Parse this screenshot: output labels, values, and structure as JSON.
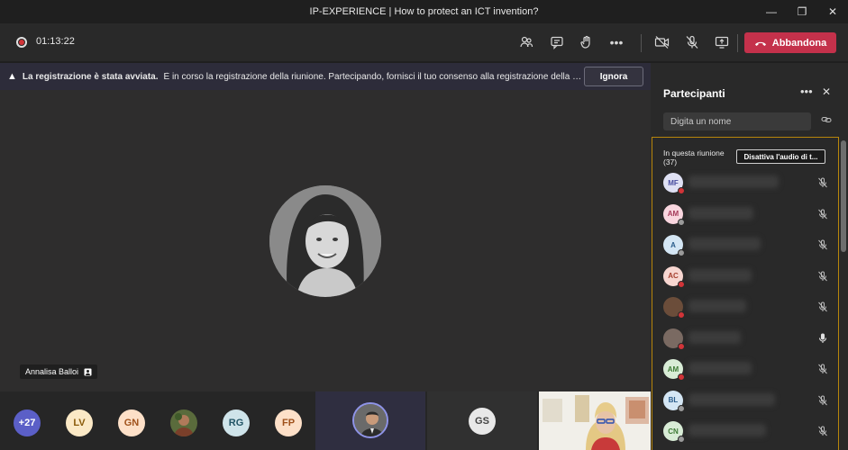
{
  "window": {
    "title": "IP-EXPERIENCE | How to protect an ICT invention?",
    "minimize": "—",
    "maximize": "❐",
    "close": "✕"
  },
  "toolbar": {
    "timer": "01:13:22",
    "leave_label": "Abbandona",
    "more": "•••"
  },
  "banner": {
    "warn_icon": "▲",
    "bold_text": "La registrazione è stata avviata.",
    "message": "È in corso la registrazione della riunione. Partecipando, fornisci il tuo consenso alla registrazione della riunio...",
    "ignore_label": "Ignora"
  },
  "stage": {
    "speaker_name": "Annalisa Balloi"
  },
  "strip": {
    "overflow_count": "+27",
    "avatars": [
      {
        "initials": "LV",
        "bg": "#fbe9c6",
        "fg": "#8a5b0a"
      },
      {
        "initials": "GN",
        "bg": "#fde0c8",
        "fg": "#a0521c"
      },
      {
        "initials": "RG",
        "bg": "#cfe4ea",
        "fg": "#225566"
      },
      {
        "initials": "FP",
        "bg": "#fde0c8",
        "fg": "#a0521c"
      }
    ],
    "gs_initials": "GS"
  },
  "panel": {
    "title": "Partecipanti",
    "more": "•••",
    "close": "✕",
    "search_placeholder": "Digita un nome",
    "section_label": "In questa riunione (37)",
    "mute_all_label": "Disattiva l'audio di t...",
    "participants": [
      {
        "initials": "MF",
        "bg": "#dfe1f4",
        "fg": "#474c9e",
        "status": "#d13438",
        "mic": "muted"
      },
      {
        "initials": "AM",
        "bg": "#f9d6df",
        "fg": "#a53a5a",
        "status": "#9a9a9a",
        "mic": "muted"
      },
      {
        "initials": "A",
        "bg": "#d4e6f4",
        "fg": "#2a5c8a",
        "status": "#9a9a9a",
        "mic": "muted"
      },
      {
        "initials": "AC",
        "bg": "#f7d6d0",
        "fg": "#a6402f",
        "status": "#d13438",
        "mic": "muted"
      },
      {
        "initials": "",
        "bg": "#6b4d3a",
        "fg": "#fff",
        "status": "#d13438",
        "mic": "muted"
      },
      {
        "initials": "",
        "bg": "#7a6a62",
        "fg": "#fff",
        "status": "#d13438",
        "mic": "on"
      },
      {
        "initials": "AM",
        "bg": "#d8ecd6",
        "fg": "#3d7a35",
        "status": "#d13438",
        "mic": "muted"
      },
      {
        "initials": "BL",
        "bg": "#d4e6f4",
        "fg": "#2a5c8a",
        "status": "#9a9a9a",
        "mic": "muted"
      },
      {
        "initials": "CN",
        "bg": "#d8ecd6",
        "fg": "#3d7a35",
        "status": "#9a9a9a",
        "mic": "muted"
      }
    ]
  }
}
